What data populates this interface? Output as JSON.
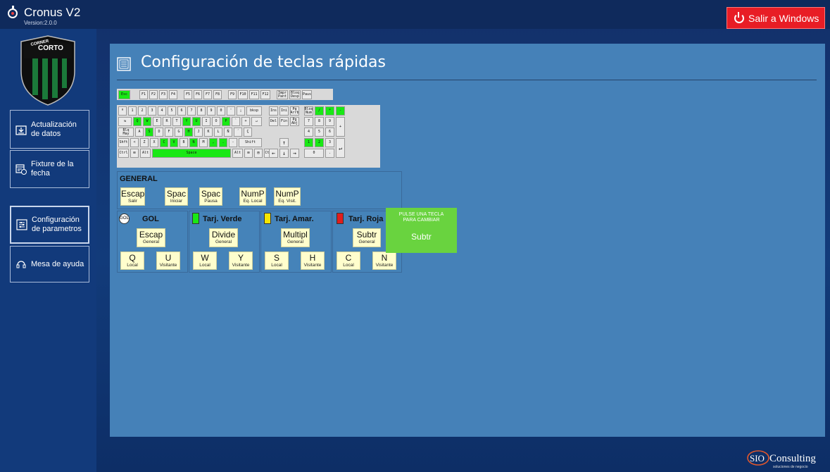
{
  "app": {
    "title": "Cronus V2",
    "version": "Version:2.0.0"
  },
  "exit_button": {
    "label": "Salir a Windows"
  },
  "sidebar": {
    "logo_text_top": "CORNER",
    "logo_text_main": "CORTO",
    "items": [
      {
        "line1": "Actualización",
        "line2": "de datos",
        "icon": "download-folder-icon"
      },
      {
        "line1": "Fixture de la",
        "line2": "fecha",
        "icon": "calendar-icon"
      },
      {
        "line1": "Configuración",
        "line2": "de parametros",
        "icon": "settings-panel-icon"
      },
      {
        "line1": "Mesa de ayuda",
        "line2": "",
        "icon": "headset-icon"
      }
    ]
  },
  "page": {
    "title": "Configuración de teclas rápidas"
  },
  "keyboard": {
    "fn_row": [
      "Esc",
      "F1",
      "F2",
      "F3",
      "F4",
      "F5",
      "F6",
      "F7",
      "F8",
      "F9",
      "F10",
      "F11",
      "F12",
      "Impr Pant",
      "Bloq Desp",
      "Paus"
    ],
    "row1": [
      "º",
      "1",
      "2",
      "3",
      "4",
      "5",
      "6",
      "7",
      "8",
      "9",
      "0",
      "'",
      "¡",
      "bksp"
    ],
    "row2": [
      "⇆",
      "Q",
      "W",
      "E",
      "R",
      "T",
      "Y",
      "U",
      "I",
      "O",
      "P",
      "`",
      "+",
      "↵"
    ],
    "row3": [
      "Blq May",
      "A",
      "S",
      "D",
      "F",
      "G",
      "H",
      "J",
      "K",
      "L",
      "Ñ",
      "´",
      "Ç"
    ],
    "row4": [
      "Shft",
      "<",
      "Z",
      "X",
      "C",
      "V",
      "B",
      "N",
      "M",
      ",",
      ".",
      "-",
      "Shift"
    ],
    "row5": [
      "Ctrl",
      "⊞",
      "Alt",
      "Space",
      "Alt",
      "⊞",
      "▤",
      "Ctrl"
    ],
    "nav1": [
      "Ins",
      "Ini",
      "Pg Arrb"
    ],
    "nav2": [
      "Del",
      "Fin",
      "Pg Abj"
    ],
    "arrows": [
      "↑",
      "←",
      "↓",
      "→"
    ],
    "numpad": [
      "Bloq Num",
      "/",
      "*",
      "-",
      "7",
      "8",
      "9",
      "+",
      "4",
      "5",
      "6",
      "1",
      "2",
      "3",
      "↵",
      "0",
      "."
    ]
  },
  "general": {
    "title": "GENERAL",
    "keys": [
      {
        "value": "Escap",
        "desc": "Salir"
      },
      {
        "value": "Spac",
        "desc": "Iniciar"
      },
      {
        "value": "Spac",
        "desc": "Pausa"
      },
      {
        "value": "NumP",
        "desc": "Eq. Local"
      },
      {
        "value": "NumP",
        "desc": "Eq. Visit."
      }
    ]
  },
  "groups": [
    {
      "title": "GOL",
      "badge": "GOL",
      "color": "",
      "main": {
        "value": "Escap",
        "desc": "General"
      },
      "local": {
        "value": "Q",
        "desc": "Local"
      },
      "visit": {
        "value": "U",
        "desc": "Visitante"
      }
    },
    {
      "title": "Tarj. Verde",
      "color": "#19e815",
      "main": {
        "value": "Divide",
        "desc": "General"
      },
      "local": {
        "value": "W",
        "desc": "Local"
      },
      "visit": {
        "value": "Y",
        "desc": "Visitante"
      }
    },
    {
      "title": "Tarj. Amar.",
      "color": "#f5e600",
      "main": {
        "value": "Multipl",
        "desc": "General"
      },
      "local": {
        "value": "S",
        "desc": "Local"
      },
      "visit": {
        "value": "H",
        "desc": "Visitante"
      }
    },
    {
      "title": "Tarj. Roja",
      "color": "#e11d1d",
      "main": {
        "value": "Subtr",
        "desc": "General"
      },
      "local": {
        "value": "C",
        "desc": "Local"
      },
      "visit": {
        "value": "N",
        "desc": "Visitante"
      }
    }
  ],
  "prompt": {
    "line1": "PULSE UNA TECLA",
    "line2": "PARA CAMBIAR",
    "value": "Subtr"
  },
  "footer": {
    "brand_sio": "SIO",
    "brand_name": "Consulting",
    "tagline": "soluciones de negocio"
  },
  "colors": {
    "accent_green": "#19e815",
    "panel": "#4581b8",
    "key_bg": "#fffecd",
    "exit_red": "#e81d25"
  }
}
